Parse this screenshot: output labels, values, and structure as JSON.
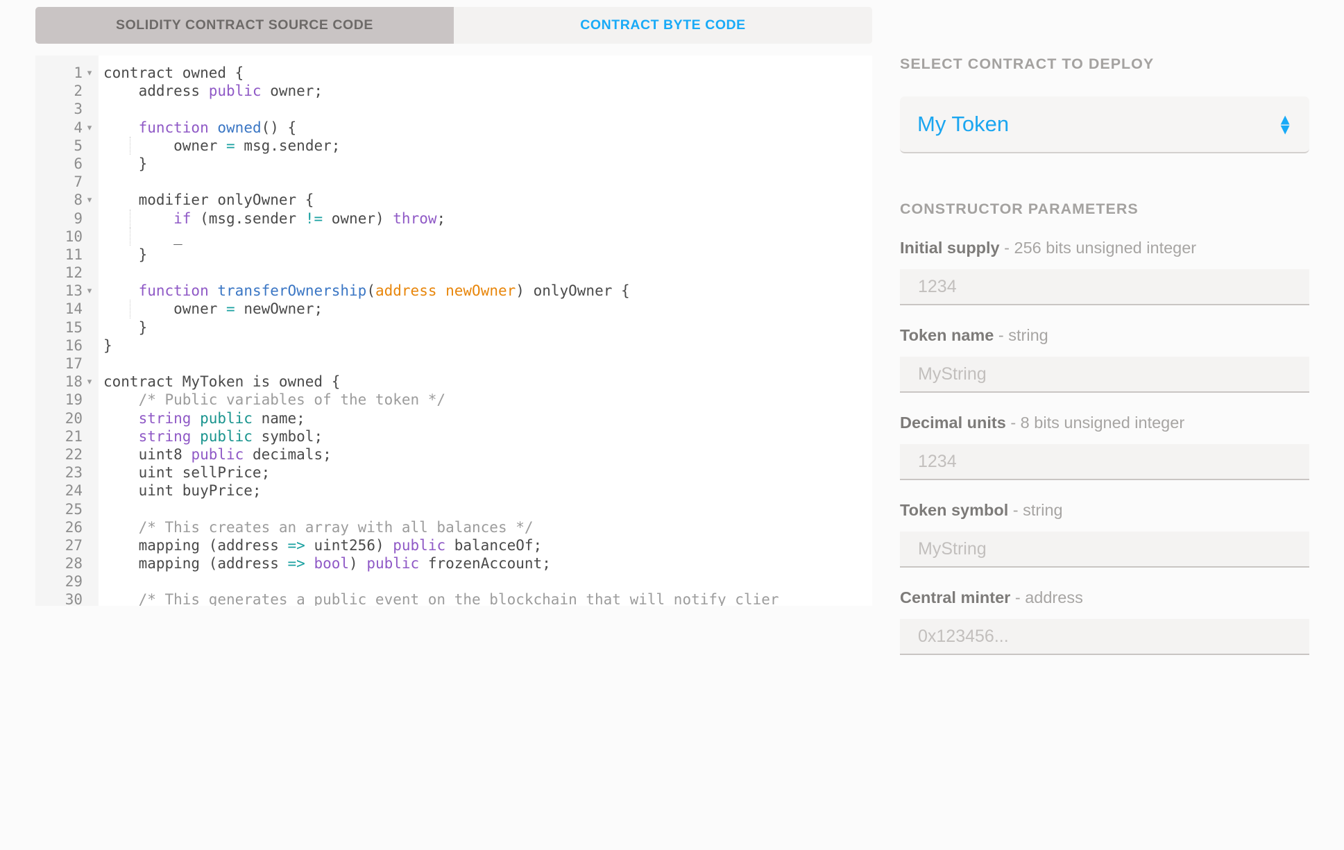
{
  "tabs": [
    {
      "label": "SOLIDITY CONTRACT SOURCE CODE",
      "active": true
    },
    {
      "label": "CONTRACT BYTE CODE",
      "active": false
    }
  ],
  "editor": {
    "language": "solidity",
    "visible_line_range": [
      1,
      30
    ],
    "lines": [
      {
        "n": 1,
        "fold": true,
        "guide": false
      },
      {
        "n": 2,
        "fold": false,
        "guide": false
      },
      {
        "n": 3,
        "fold": false,
        "guide": false
      },
      {
        "n": 4,
        "fold": true,
        "guide": false
      },
      {
        "n": 5,
        "fold": false,
        "guide": true
      },
      {
        "n": 6,
        "fold": false,
        "guide": false
      },
      {
        "n": 7,
        "fold": false,
        "guide": false
      },
      {
        "n": 8,
        "fold": true,
        "guide": false
      },
      {
        "n": 9,
        "fold": false,
        "guide": true
      },
      {
        "n": 10,
        "fold": false,
        "guide": true
      },
      {
        "n": 11,
        "fold": false,
        "guide": false
      },
      {
        "n": 12,
        "fold": false,
        "guide": false
      },
      {
        "n": 13,
        "fold": true,
        "guide": false
      },
      {
        "n": 14,
        "fold": false,
        "guide": true
      },
      {
        "n": 15,
        "fold": false,
        "guide": false
      },
      {
        "n": 16,
        "fold": false,
        "guide": false
      },
      {
        "n": 17,
        "fold": false,
        "guide": false
      },
      {
        "n": 18,
        "fold": true,
        "guide": false
      },
      {
        "n": 19,
        "fold": false,
        "guide": false
      },
      {
        "n": 20,
        "fold": false,
        "guide": false
      },
      {
        "n": 21,
        "fold": false,
        "guide": false
      },
      {
        "n": 22,
        "fold": false,
        "guide": false
      },
      {
        "n": 23,
        "fold": false,
        "guide": false
      },
      {
        "n": 24,
        "fold": false,
        "guide": false
      },
      {
        "n": 25,
        "fold": false,
        "guide": false
      },
      {
        "n": 26,
        "fold": false,
        "guide": false
      },
      {
        "n": 27,
        "fold": false,
        "guide": false
      },
      {
        "n": 28,
        "fold": false,
        "guide": false
      },
      {
        "n": 29,
        "fold": false,
        "guide": false
      },
      {
        "n": 30,
        "fold": false,
        "guide": false
      }
    ],
    "source_text": [
      "contract owned {",
      "    address public owner;",
      "",
      "    function owned() {",
      "        owner = msg.sender;",
      "    }",
      "",
      "    modifier onlyOwner {",
      "        if (msg.sender != owner) throw;",
      "        _",
      "    }",
      "",
      "    function transferOwnership(address newOwner) onlyOwner {",
      "        owner = newOwner;",
      "    }",
      "}",
      "",
      "contract MyToken is owned {",
      "    /* Public variables of the token */",
      "    string public name;",
      "    string public symbol;",
      "    uint8 public decimals;",
      "    uint sellPrice;",
      "    uint buyPrice;",
      "",
      "    /* This creates an array with all balances */",
      "    mapping (address => uint256) public balanceOf;",
      "    mapping (address => bool) public frozenAccount;",
      "",
      "    /* This generates a public event on the blockchain that will notify clier"
    ],
    "tokens": [
      [
        {
          "t": "contract owned {",
          "c": "def"
        }
      ],
      [
        {
          "t": "    address ",
          "c": "def"
        },
        {
          "t": "public",
          "c": "kw"
        },
        {
          "t": " owner;",
          "c": "def"
        }
      ],
      [],
      [
        {
          "t": "    ",
          "c": "def"
        },
        {
          "t": "function",
          "c": "kw"
        },
        {
          "t": " ",
          "c": "def"
        },
        {
          "t": "owned",
          "c": "fn"
        },
        {
          "t": "() {",
          "c": "def"
        }
      ],
      [
        {
          "t": "        owner ",
          "c": "def"
        },
        {
          "t": "=",
          "c": "op"
        },
        {
          "t": " msg.sender;",
          "c": "def"
        }
      ],
      [
        {
          "t": "    }",
          "c": "def"
        }
      ],
      [],
      [
        {
          "t": "    modifier onlyOwner {",
          "c": "def"
        }
      ],
      [
        {
          "t": "        ",
          "c": "def"
        },
        {
          "t": "if",
          "c": "kw"
        },
        {
          "t": " (msg.sender ",
          "c": "def"
        },
        {
          "t": "!=",
          "c": "op"
        },
        {
          "t": " owner) ",
          "c": "def"
        },
        {
          "t": "throw",
          "c": "kw"
        },
        {
          "t": ";",
          "c": "def"
        }
      ],
      [
        {
          "t": "        _",
          "c": "def"
        }
      ],
      [
        {
          "t": "    }",
          "c": "def"
        }
      ],
      [],
      [
        {
          "t": "    ",
          "c": "def"
        },
        {
          "t": "function",
          "c": "kw"
        },
        {
          "t": " ",
          "c": "def"
        },
        {
          "t": "transferOwnership",
          "c": "fn"
        },
        {
          "t": "(",
          "c": "def"
        },
        {
          "t": "address newOwner",
          "c": "par"
        },
        {
          "t": ") onlyOwner {",
          "c": "def"
        }
      ],
      [
        {
          "t": "        owner ",
          "c": "def"
        },
        {
          "t": "=",
          "c": "op"
        },
        {
          "t": " newOwner;",
          "c": "def"
        }
      ],
      [
        {
          "t": "    }",
          "c": "def"
        }
      ],
      [
        {
          "t": "}",
          "c": "def"
        }
      ],
      [],
      [
        {
          "t": "contract MyToken is owned {",
          "c": "def"
        }
      ],
      [
        {
          "t": "    /* Public variables of the token */",
          "c": "com"
        }
      ],
      [
        {
          "t": "    ",
          "c": "def"
        },
        {
          "t": "string",
          "c": "kw"
        },
        {
          "t": " ",
          "c": "def"
        },
        {
          "t": "public",
          "c": "pub"
        },
        {
          "t": " name;",
          "c": "def"
        }
      ],
      [
        {
          "t": "    ",
          "c": "def"
        },
        {
          "t": "string",
          "c": "kw"
        },
        {
          "t": " ",
          "c": "def"
        },
        {
          "t": "public",
          "c": "pub"
        },
        {
          "t": " symbol;",
          "c": "def"
        }
      ],
      [
        {
          "t": "    uint8 ",
          "c": "def"
        },
        {
          "t": "public",
          "c": "kw"
        },
        {
          "t": " decimals;",
          "c": "def"
        }
      ],
      [
        {
          "t": "    uint sellPrice;",
          "c": "def"
        }
      ],
      [
        {
          "t": "    uint buyPrice;",
          "c": "def"
        }
      ],
      [],
      [
        {
          "t": "    /* This creates an array with all balances */",
          "c": "com"
        }
      ],
      [
        {
          "t": "    mapping (address ",
          "c": "def"
        },
        {
          "t": "=>",
          "c": "op"
        },
        {
          "t": " uint256) ",
          "c": "def"
        },
        {
          "t": "public",
          "c": "kw"
        },
        {
          "t": " balanceOf;",
          "c": "def"
        }
      ],
      [
        {
          "t": "    mapping (address ",
          "c": "def"
        },
        {
          "t": "=>",
          "c": "op"
        },
        {
          "t": " ",
          "c": "def"
        },
        {
          "t": "bool",
          "c": "kw"
        },
        {
          "t": ") ",
          "c": "def"
        },
        {
          "t": "public",
          "c": "kw"
        },
        {
          "t": " frozenAccount;",
          "c": "def"
        }
      ],
      [],
      [
        {
          "t": "    /* This generates a public event on the blockchain that will notify clier",
          "c": "com"
        }
      ]
    ],
    "fold_marker": "▾"
  },
  "right_panel": {
    "select_section": {
      "title": "SELECT CONTRACT TO DEPLOY",
      "selected_value": "My Token",
      "stepper_up": "▲",
      "stepper_down": "▼"
    },
    "constructor_section": {
      "title": "CONSTRUCTOR PARAMETERS",
      "fields": [
        {
          "name": "Initial supply",
          "type": " - 256 bits unsigned integer",
          "value": "",
          "placeholder": "1234"
        },
        {
          "name": "Token name",
          "type": " - string",
          "value": "",
          "placeholder": "MyString"
        },
        {
          "name": "Decimal units",
          "type": " - 8 bits unsigned integer",
          "value": "",
          "placeholder": "1234"
        },
        {
          "name": "Token symbol",
          "type": " - string",
          "value": "",
          "placeholder": "MyString"
        },
        {
          "name": "Central minter",
          "type": " - address",
          "value": "",
          "placeholder": "0x123456..."
        }
      ]
    }
  },
  "colors": {
    "accent_blue": "#18aaf7",
    "active_tab_bg": "#c9c4c4",
    "page_bg": "#fbfbfb",
    "editor_bg": "#ffffff",
    "gutter_bg": "#f5f5f5",
    "keyword_purple": "#8f59c6",
    "function_blue": "#3a76c4",
    "param_orange": "#e8860b",
    "operator_teal": "#19a0a0",
    "comment_gray": "#9c9c9c",
    "scrollbar_thumb": "#7e7e7e"
  }
}
